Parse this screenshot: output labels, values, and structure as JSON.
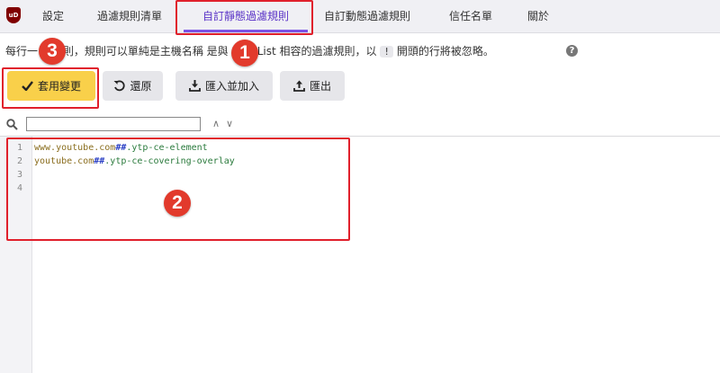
{
  "app": {
    "logo_text": "uD"
  },
  "tabs": [
    {
      "label": "設定"
    },
    {
      "label": "過濾規則清單"
    },
    {
      "label": "自訂靜態過濾規則",
      "active": true
    },
    {
      "label": "自訂動態過濾規則"
    },
    {
      "label": "信任名單"
    },
    {
      "label": "關於"
    }
  ],
  "description": {
    "text_before": "每行一 濾規則，規則可以單純是主機名稱 是與 EasyList 相容的過濾規則，以",
    "kbd": "!",
    "text_after": "開頭的行將被忽略。",
    "help_icon": "?"
  },
  "toolbar": {
    "apply_label": "套用變更",
    "revert_label": "還原",
    "import_label": "匯入並加入",
    "export_label": "匯出"
  },
  "search": {
    "value": "",
    "placeholder": ""
  },
  "editor": {
    "line_numbers": [
      "1",
      "2",
      "3",
      "4"
    ],
    "lines": [
      {
        "host": "www.youtube.com",
        "sep": "##",
        "selector": ".ytp-ce-element"
      },
      {
        "host": "youtube.com",
        "sep": "##",
        "selector": ".ytp-ce-covering-overlay"
      }
    ]
  },
  "annotations": [
    "1",
    "2",
    "3"
  ],
  "colors": {
    "accent": "#7b52e6",
    "primary_button": "#f9d04a",
    "highlight": "#e0202c"
  }
}
